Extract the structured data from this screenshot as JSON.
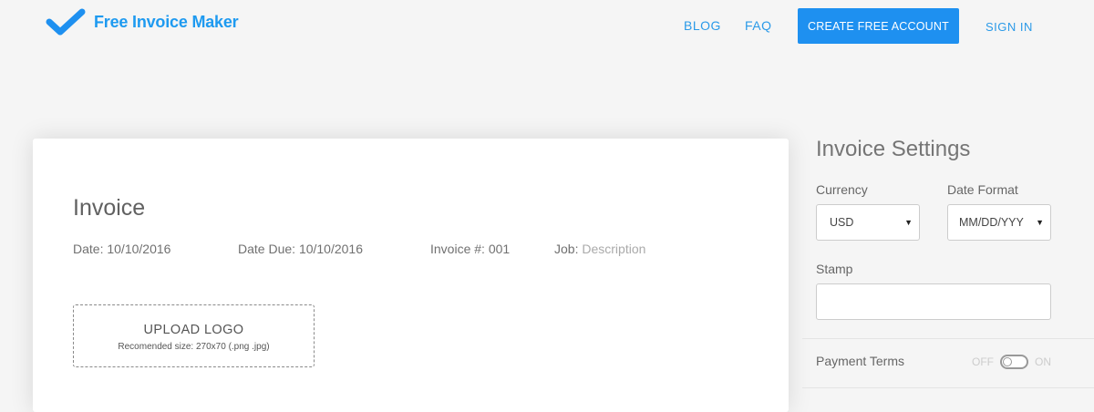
{
  "brand": {
    "name": "Free Invoice Maker",
    "logo_icon": "checkmark-icon",
    "accent_color": "#1e90f0"
  },
  "nav": {
    "blog": "BLOG",
    "faq": "FAQ",
    "create_account": "CREATE FREE ACCOUNT",
    "sign_in": "SIGN IN"
  },
  "invoice": {
    "title": "Invoice",
    "date_label": "Date:",
    "date_value": "10/10/2016",
    "due_label": "Date Due:",
    "due_value": "10/10/2016",
    "number_label": "Invoice #:",
    "number_value": "001",
    "job_label": "Job:",
    "job_placeholder": "Description",
    "upload_title": "UPLOAD LOGO",
    "upload_hint": "Recomended size: 270x70 (.png .jpg)"
  },
  "settings": {
    "title": "Invoice Settings",
    "currency_label": "Currency",
    "currency_value": "USD",
    "date_format_label": "Date Format",
    "date_format_value": "MM/DD/YYY",
    "stamp_label": "Stamp",
    "stamp_value": "",
    "payment_terms_label": "Payment Terms",
    "toggle_off": "OFF",
    "toggle_on": "ON"
  }
}
